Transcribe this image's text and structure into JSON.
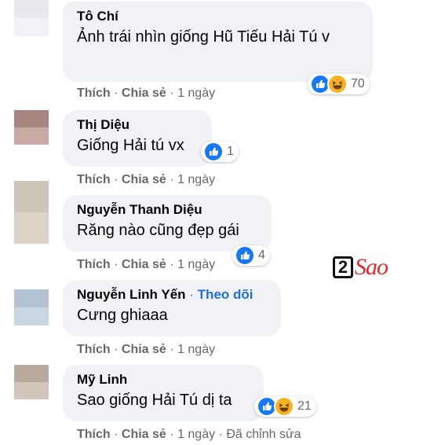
{
  "comments": [
    {
      "author": "Tô Chí",
      "text": "Ảnh trái nhìn giống Hũ Tiếu Hải Tú v",
      "reaction_count": "70",
      "reactions": [
        "like-icon",
        "haha-icon"
      ],
      "like_label": "Thích",
      "share_label": "Chia sẻ",
      "time": "1 ngày"
    },
    {
      "author": "Thị Diệu",
      "text": "Giống Hải tú vx",
      "reaction_count": "1",
      "reactions": [
        "like-icon"
      ],
      "like_label": "Thích",
      "share_label": "Chia sẻ",
      "time": "1 ngày"
    },
    {
      "author": "Nguyễn Thanh Diệu",
      "text": "Răng nào cũng đẹp gái",
      "reaction_count": "4",
      "reactions": [
        "like-icon"
      ],
      "like_label": "Thích",
      "share_label": "Chia sẻ",
      "time": "1 ngày"
    },
    {
      "author": "Nguyễn Linh Yến",
      "follow_label": "Theo dõi",
      "text": "Cưng ghiaaa",
      "like_label": "Thích",
      "share_label": "Chia sẻ",
      "time": "1 ngày"
    },
    {
      "author": "Mỹ Linh",
      "text": "Sao giống Hải Tú dị ta",
      "reaction_count": "21",
      "reactions": [
        "like-icon",
        "haha-icon"
      ],
      "like_label": "Thích",
      "share_label": "Chia sẻ",
      "time": "1 ngày",
      "edited_label": "Đã chỉnh sửa"
    }
  ],
  "separator": "·",
  "watermark": {
    "number": "2",
    "text": "Sao"
  },
  "colors": {
    "bubble": "#f0f2f5",
    "link": "#216fdb",
    "meta": "#65676b",
    "like": "#1877f2",
    "haha": "#f7b125",
    "watermark_red": "#e0282f"
  }
}
